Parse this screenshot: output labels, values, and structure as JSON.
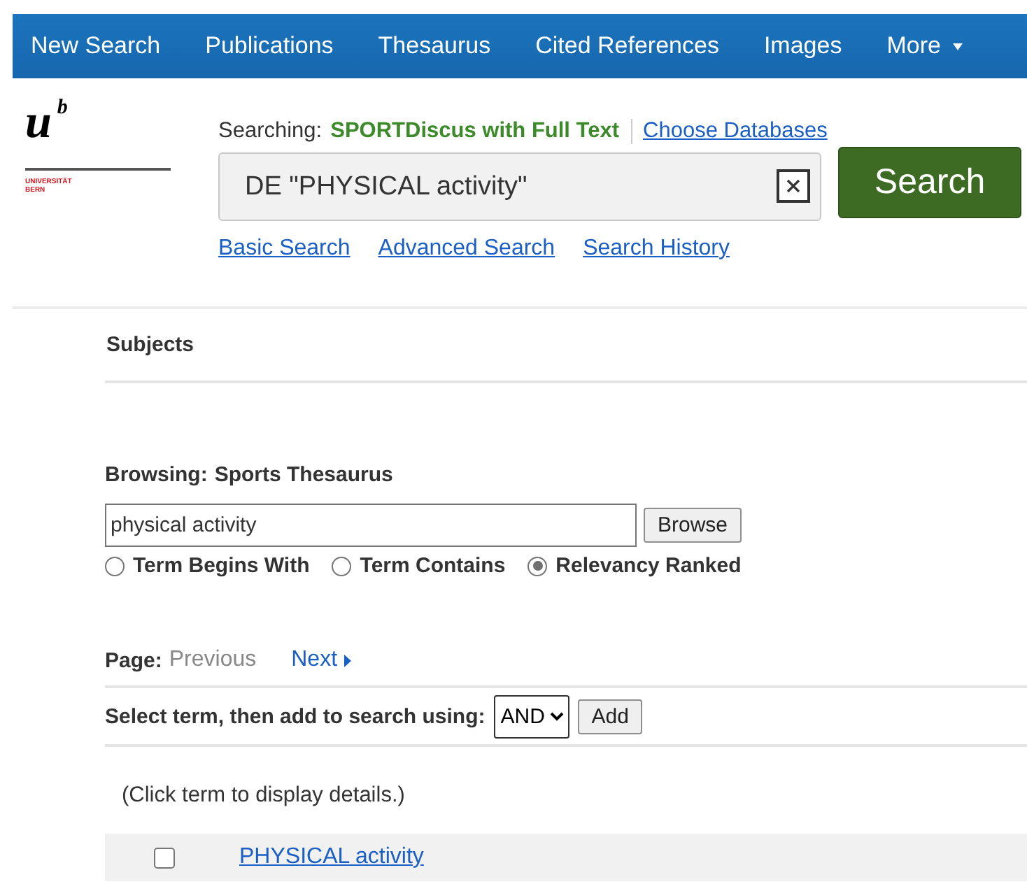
{
  "nav": {
    "items": [
      {
        "label": "New Search",
        "kind": "link"
      },
      {
        "label": "Publications",
        "kind": "link"
      },
      {
        "label": "Thesaurus",
        "kind": "link"
      },
      {
        "label": "Cited References",
        "kind": "link"
      },
      {
        "label": "Images",
        "kind": "link"
      },
      {
        "label": "More",
        "kind": "menu"
      }
    ]
  },
  "logo": {
    "letter": "u",
    "superscript": "b",
    "name_lines": [
      "UNIVERSITÄT",
      "BERN"
    ]
  },
  "searching": {
    "label": "Searching:",
    "database": "SPORTDiscus with Full Text",
    "link": "Choose Databases"
  },
  "search": {
    "value": "DE \"PHYSICAL activity\"",
    "button": "Search"
  },
  "search_links": [
    "Basic Search",
    "Advanced Search",
    "Search History"
  ],
  "section_title": "Subjects",
  "browsing": {
    "label": "Browsing:",
    "thesaurus": "Sports Thesaurus",
    "value": "physical activity",
    "button": "Browse"
  },
  "modes": [
    {
      "label": "Term Begins With",
      "selected": false
    },
    {
      "label": "Term Contains",
      "selected": false
    },
    {
      "label": "Relevancy Ranked",
      "selected": true
    }
  ],
  "pager": {
    "label": "Page:",
    "previous": {
      "label": "Previous",
      "disabled": true
    },
    "next": {
      "label": "Next",
      "disabled": false
    }
  },
  "add_row": {
    "label": "Select term, then add to search using:",
    "operator": "AND",
    "button": "Add"
  },
  "hint": "(Click term to display details.)",
  "terms": [
    {
      "label": "PHYSICAL activity",
      "checked": false
    }
  ]
}
